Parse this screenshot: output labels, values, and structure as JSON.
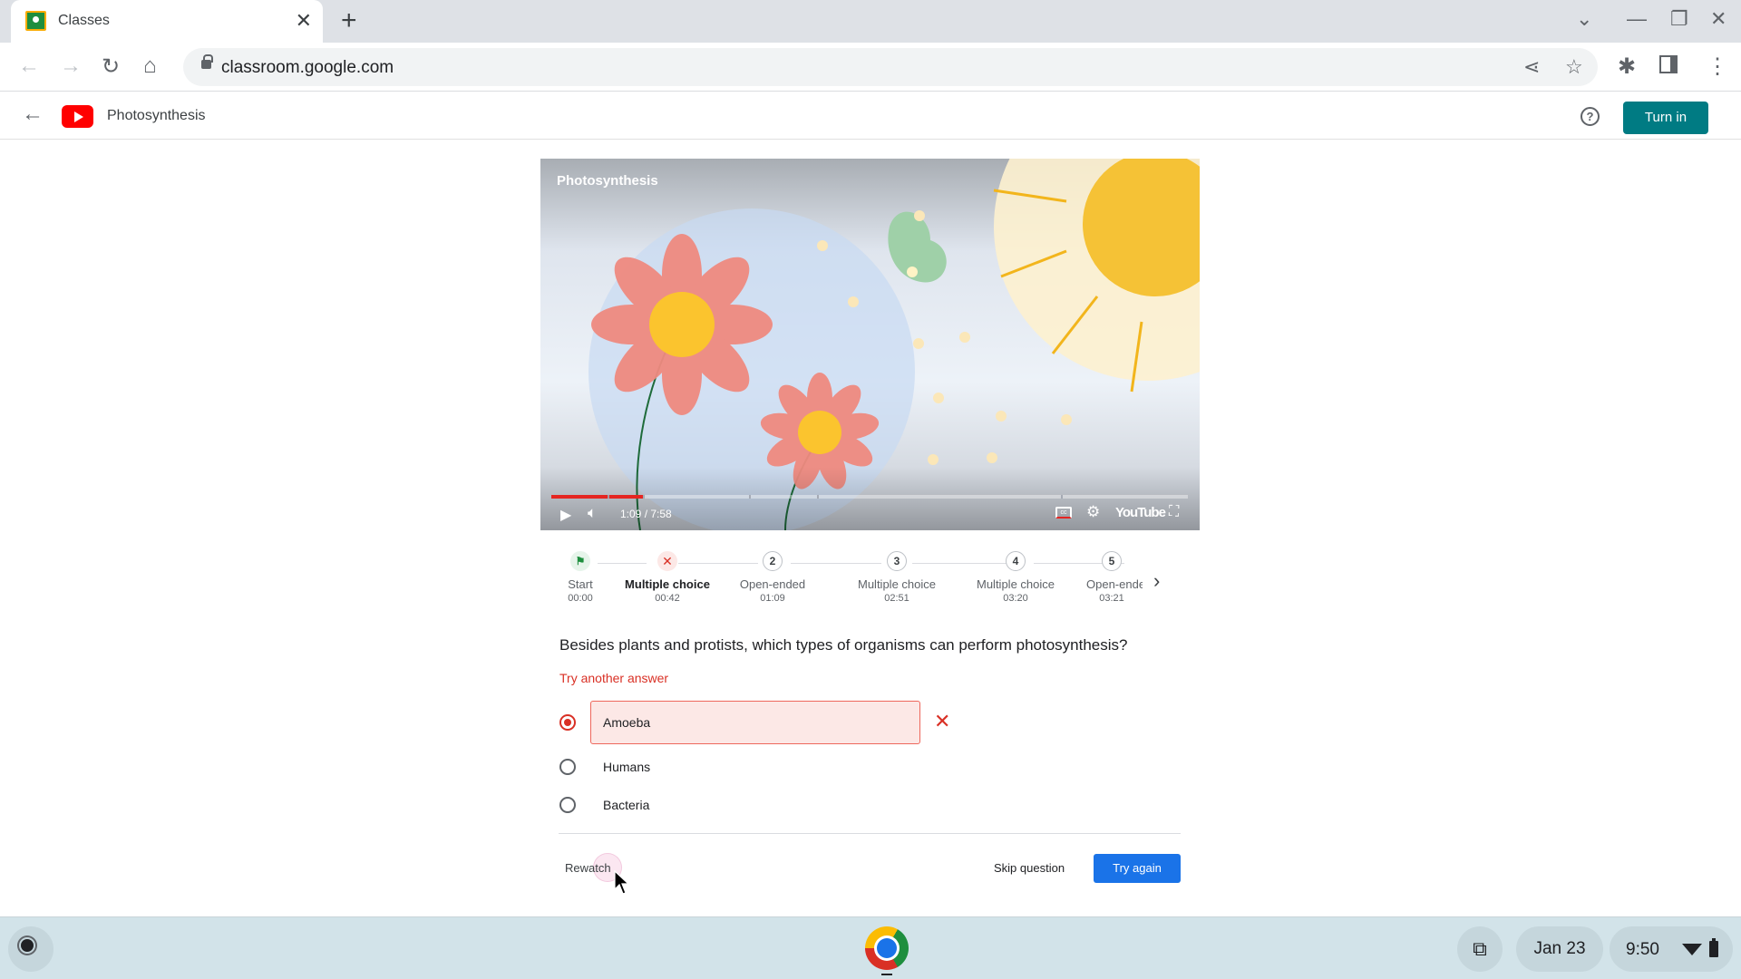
{
  "browser": {
    "tab_title": "Classes",
    "url": "classroom.google.com"
  },
  "app_header": {
    "title": "Photosynthesis",
    "turn_in_label": "Turn in"
  },
  "video": {
    "title": "Photosynthesis",
    "time_display": "1:09 / 7:58",
    "progress_fraction": 0.144,
    "logo_text": "YouTube",
    "chapter_marks_fraction": [
      0.088,
      0.144,
      0.31,
      0.417,
      0.8
    ]
  },
  "stepper": {
    "steps": [
      {
        "number": "",
        "label": "Start",
        "time": "00:00",
        "state": "start"
      },
      {
        "number": "",
        "label": "Multiple choice",
        "time": "00:42",
        "state": "wrong"
      },
      {
        "number": "2",
        "label": "Open-ended",
        "time": "01:09",
        "state": "pending"
      },
      {
        "number": "3",
        "label": "Multiple choice",
        "time": "02:51",
        "state": "pending"
      },
      {
        "number": "4",
        "label": "Multiple choice",
        "time": "03:20",
        "state": "pending"
      },
      {
        "number": "5",
        "label": "Open-ended",
        "time": "03:21",
        "state": "pending"
      }
    ]
  },
  "question": {
    "text": "Besides plants and protists, which types of organisms can perform photosynthesis?",
    "feedback": "Try another answer",
    "options": [
      {
        "label": "Amoeba",
        "selected": true,
        "incorrect": true
      },
      {
        "label": "Humans",
        "selected": false
      },
      {
        "label": "Bacteria",
        "selected": false
      }
    ],
    "rewatch_label": "Rewatch",
    "skip_label": "Skip question",
    "try_again_label": "Try again"
  },
  "shelf": {
    "date": "Jan 23",
    "time": "9:50"
  },
  "colors": {
    "turn_in": "#007b83",
    "error": "#d93025",
    "primary": "#1a73e8",
    "youtube_red": "#ff0000"
  }
}
